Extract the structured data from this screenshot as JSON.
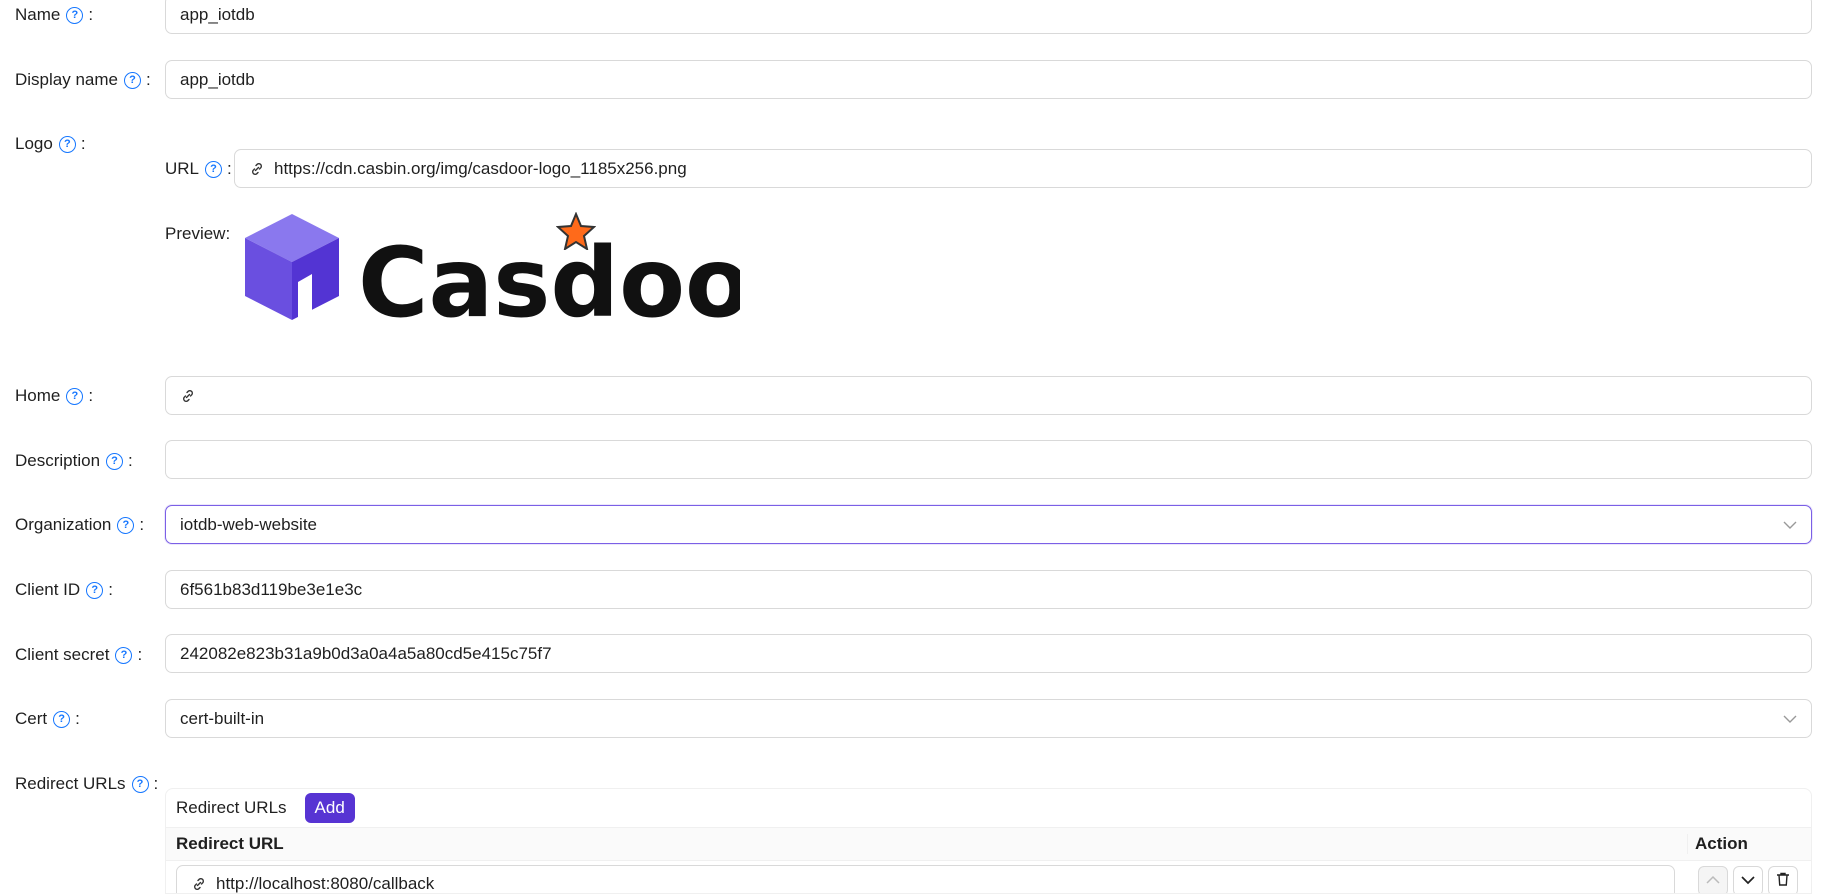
{
  "fields": {
    "name": {
      "label": "Name",
      "value": "app_iotdb"
    },
    "display_name": {
      "label": "Display name",
      "value": "app_iotdb"
    },
    "logo": {
      "label": "Logo",
      "url_label": "URL",
      "url_value": "https://cdn.casbin.org/img/casdoor-logo_1185x256.png",
      "preview_label": "Preview:",
      "logo_text": "Casdoor"
    },
    "home": {
      "label": "Home",
      "value": ""
    },
    "description": {
      "label": "Description",
      "value": ""
    },
    "organization": {
      "label": "Organization",
      "value": "iotdb-web-website"
    },
    "client_id": {
      "label": "Client ID",
      "value": "6f561b83d119be3e1e3c"
    },
    "client_secret": {
      "label": "Client secret",
      "value": "242082e823b31a9b0d3a0a4a5a80cd5e415c75f7"
    },
    "cert": {
      "label": "Cert",
      "value": "cert-built-in"
    },
    "redirect_urls": {
      "label": "Redirect URLs",
      "table_title": "Redirect URLs",
      "add_label": "Add",
      "col_url": "Redirect URL",
      "col_action": "Action",
      "rows": [
        {
          "url": "http://localhost:8080/callback"
        }
      ]
    }
  },
  "colors": {
    "accent": "#5734d3",
    "help": "#1677ff",
    "focus": "#7b5fe6"
  },
  "icons": [
    "question-circle-icon",
    "link-icon",
    "chevron-down-icon",
    "arrow-up-icon",
    "arrow-down-icon",
    "delete-icon"
  ]
}
